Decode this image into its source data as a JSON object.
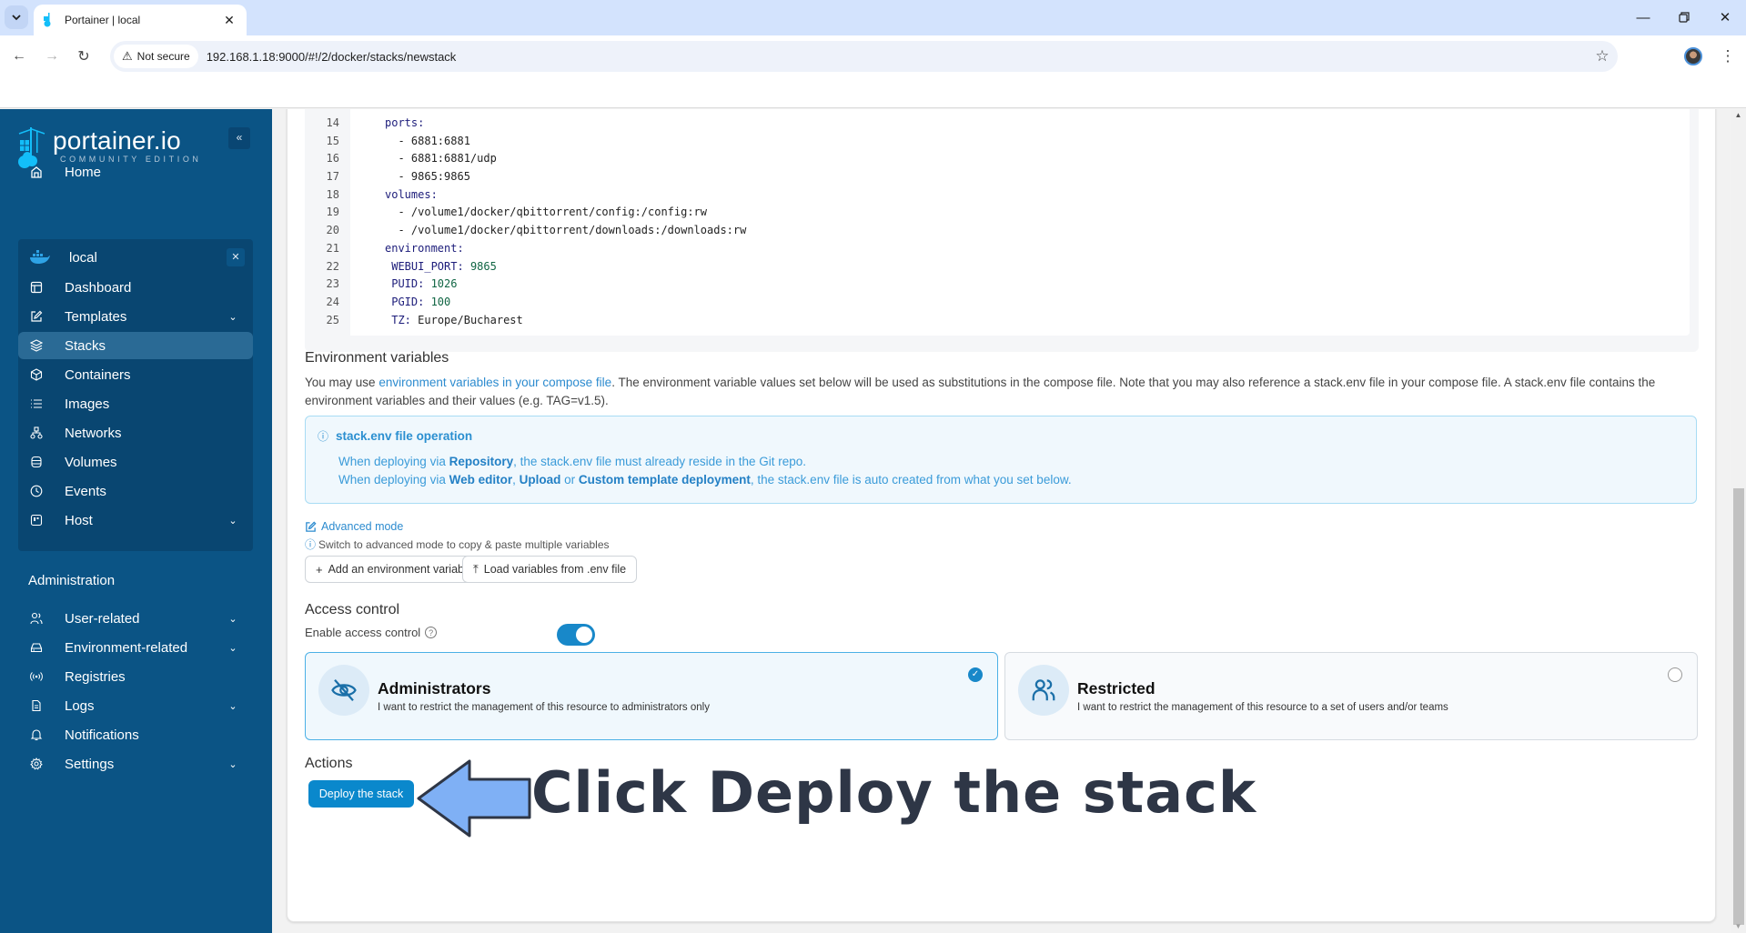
{
  "browser": {
    "tab_title": "Portainer | local",
    "security_label": "Not secure",
    "url": "192.168.1.18:9000/#!/2/docker/stacks/newstack",
    "icons": {
      "tab_menu": "chevron-down-icon",
      "back": "arrow-left-icon",
      "forward": "arrow-right-icon",
      "reload": "reload-icon",
      "warning": "warning-triangle-icon",
      "bookmark": "star-icon",
      "profile": "avatar",
      "menu": "kebab-menu-icon",
      "minimize": "minimize-icon",
      "restore": "restore-icon",
      "close": "close-icon"
    }
  },
  "sidebar": {
    "logo_name": "portainer.io",
    "logo_sub": "COMMUNITY EDITION",
    "collapse_glyph": "«",
    "home_label": "Home",
    "environment": {
      "name": "local",
      "close_glyph": "✕",
      "items": [
        {
          "label": "Dashboard",
          "icon": "dashboard-icon",
          "chevron": false,
          "active": false
        },
        {
          "label": "Templates",
          "icon": "edit-icon",
          "chevron": true,
          "active": false
        },
        {
          "label": "Stacks",
          "icon": "layers-icon",
          "chevron": false,
          "active": true
        },
        {
          "label": "Containers",
          "icon": "box-icon",
          "chevron": false,
          "active": false
        },
        {
          "label": "Images",
          "icon": "list-icon",
          "chevron": false,
          "active": false
        },
        {
          "label": "Networks",
          "icon": "network-icon",
          "chevron": false,
          "active": false
        },
        {
          "label": "Volumes",
          "icon": "database-icon",
          "chevron": false,
          "active": false
        },
        {
          "label": "Events",
          "icon": "clock-icon",
          "chevron": false,
          "active": false
        },
        {
          "label": "Host",
          "icon": "host-icon",
          "chevron": true,
          "active": false
        }
      ]
    },
    "admin_title": "Administration",
    "admin_items": [
      {
        "label": "User-related",
        "icon": "users-icon",
        "chevron": true
      },
      {
        "label": "Environment-related",
        "icon": "drive-icon",
        "chevron": true
      },
      {
        "label": "Registries",
        "icon": "radio-icon",
        "chevron": false
      },
      {
        "label": "Logs",
        "icon": "file-text-icon",
        "chevron": true
      },
      {
        "label": "Notifications",
        "icon": "bell-icon",
        "chevron": false
      },
      {
        "label": "Settings",
        "icon": "gear-icon",
        "chevron": true
      }
    ]
  },
  "editor": {
    "lines": [
      {
        "num": "14",
        "indent": "",
        "key": "ports:",
        "value": ""
      },
      {
        "num": "15",
        "indent": "  ",
        "key": "",
        "value": "- 6881:6881"
      },
      {
        "num": "16",
        "indent": "  ",
        "key": "",
        "value": "- 6881:6881/udp"
      },
      {
        "num": "17",
        "indent": "  ",
        "key": "",
        "value": "- 9865:9865"
      },
      {
        "num": "18",
        "indent": "",
        "key": "volumes:",
        "value": ""
      },
      {
        "num": "19",
        "indent": "  ",
        "key": "",
        "value": "- /volume1/docker/qbittorrent/config:/config:rw"
      },
      {
        "num": "20",
        "indent": "  ",
        "key": "",
        "value": "- /volume1/docker/qbittorrent/downloads:/downloads:rw"
      },
      {
        "num": "21",
        "indent": "",
        "key": "environment:",
        "value": ""
      },
      {
        "num": "22",
        "indent": " ",
        "key": "WEBUI_PORT:",
        "value": " 9865",
        "numeric": true
      },
      {
        "num": "23",
        "indent": " ",
        "key": "PUID:",
        "value": " 1026",
        "numeric": true
      },
      {
        "num": "24",
        "indent": " ",
        "key": "PGID:",
        "value": " 100",
        "numeric": true
      },
      {
        "num": "25",
        "indent": " ",
        "key": "TZ:",
        "value": " Europe/Bucharest",
        "numeric": false
      }
    ]
  },
  "env_vars": {
    "title": "Environment variables",
    "desc_prefix": "You may use ",
    "desc_link": "environment variables in your compose file",
    "desc_suffix": ". The environment variable values set below will be used as substitutions in the compose file. Note that you may also reference a stack.env file in your compose file. A stack.env file contains the environment variables and their values (e.g. TAG=v1.5).",
    "info": {
      "title": "stack.env file operation",
      "line1_a": "When deploying via ",
      "line1_b": "Repository",
      "line1_c": ", the stack.env file must already reside in the Git repo.",
      "line2_a": "When deploying via ",
      "line2_b": "Web editor",
      "line2_c": ", ",
      "line2_d": "Upload",
      "line2_e": " or ",
      "line2_f": "Custom template deployment",
      "line2_g": ", the stack.env file is auto created from what you set below."
    },
    "advanced_mode": "Advanced mode",
    "advanced_hint": "Switch to advanced mode to copy & paste multiple variables",
    "add_button": "Add an environment variable",
    "load_button": "Load variables from .env file"
  },
  "access_control": {
    "title": "Access control",
    "enable_label": "Enable access control",
    "enabled": true,
    "options": [
      {
        "title": "Administrators",
        "desc": "I want to restrict the management of this resource to administrators only",
        "selected": true
      },
      {
        "title": "Restricted",
        "desc": "I want to restrict the management of this resource to a set of users and/or teams",
        "selected": false
      }
    ]
  },
  "actions": {
    "title": "Actions",
    "deploy_button": "Deploy the stack"
  },
  "annotation": {
    "text": "Click Deploy the stack"
  },
  "colors": {
    "sidebar_bg": "#0b5485",
    "accent": "#0a88cc",
    "info_text": "#3a9bd9",
    "annotation_arrow": "#7fb0f5",
    "annotation_text": "#2e3646"
  }
}
